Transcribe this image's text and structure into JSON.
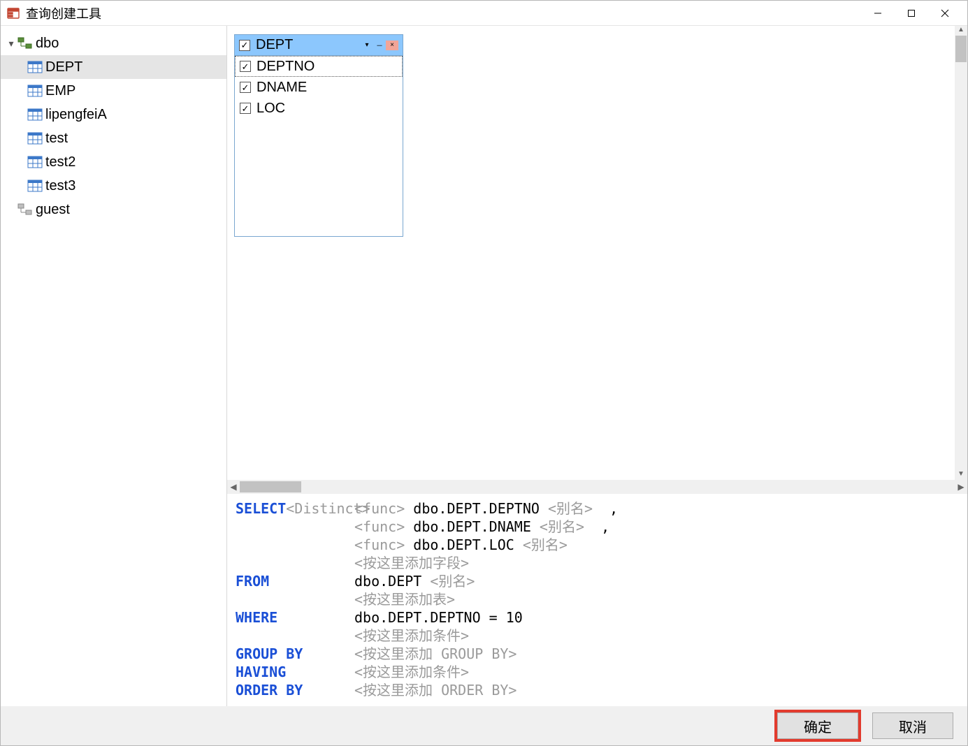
{
  "window": {
    "title": "查询创建工具"
  },
  "tree": {
    "dbo": {
      "label": "dbo",
      "expanded": true,
      "tables": [
        {
          "label": "DEPT",
          "selected": true
        },
        {
          "label": "EMP"
        },
        {
          "label": "lipengfeiA"
        },
        {
          "label": "test"
        },
        {
          "label": "test2"
        },
        {
          "label": "test3"
        }
      ]
    },
    "guest": {
      "label": "guest"
    }
  },
  "table_card": {
    "title": "DEPT",
    "title_checked": true,
    "columns": [
      {
        "label": "DEPTNO",
        "checked": true,
        "active": true
      },
      {
        "label": "DNAME",
        "checked": true
      },
      {
        "label": "LOC",
        "checked": true
      }
    ]
  },
  "sql": {
    "select_kw": "SELECT",
    "distinct_hint": "<Distinct>",
    "func_hint": "<func>",
    "alias_hint": "<别名>",
    "add_field_hint": "<按这里添加字段>",
    "fields": [
      "dbo.DEPT.DEPTNO",
      "dbo.DEPT.DNAME",
      "dbo.DEPT.LOC"
    ],
    "from_kw": "FROM",
    "from_table": "dbo.DEPT",
    "add_table_hint": "<按这里添加表>",
    "where_kw": "WHERE",
    "where_expr": "dbo.DEPT.DEPTNO = 10",
    "add_cond_hint": "<按这里添加条件>",
    "groupby_kw": "GROUP BY",
    "add_groupby_hint": "<按这里添加 GROUP BY>",
    "having_kw": "HAVING",
    "orderby_kw": "ORDER BY",
    "add_orderby_hint": "<按这里添加 ORDER BY>"
  },
  "buttons": {
    "ok": "确定",
    "cancel": "取消"
  }
}
